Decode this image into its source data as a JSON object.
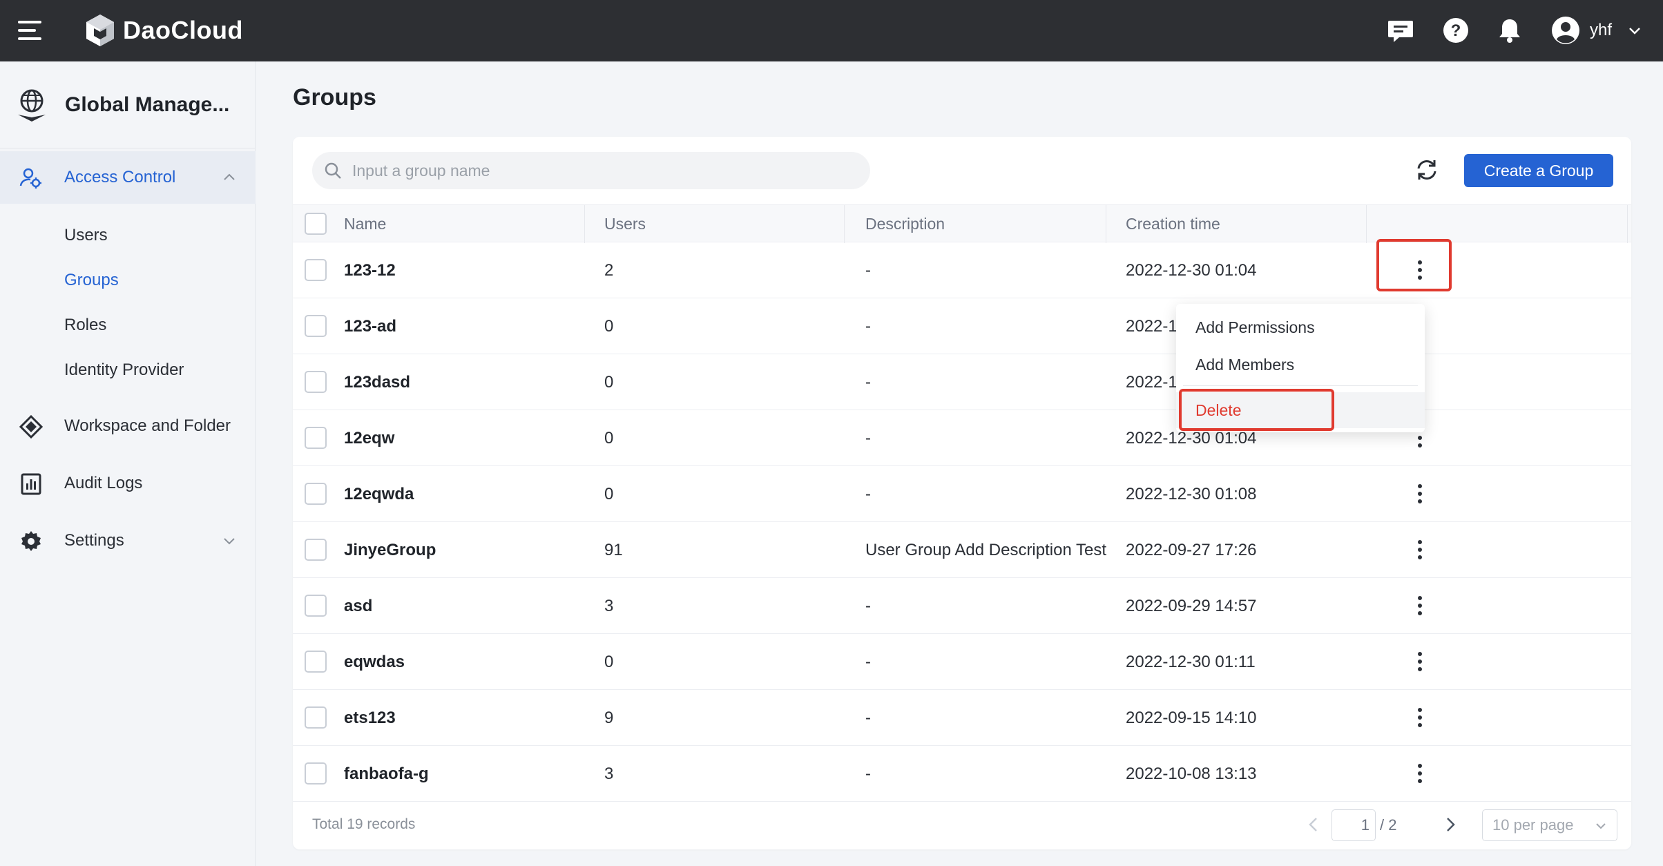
{
  "topbar": {
    "brand": "DaoCloud",
    "user_name": "yhf",
    "icons": [
      "menu-icon",
      "logo-icon",
      "message-icon",
      "help-icon",
      "bell-icon",
      "user-avatar-icon",
      "chevron-down-icon"
    ]
  },
  "sidebar": {
    "module_title": "Global Manage...",
    "access_control": "Access Control",
    "sub_items": [
      "Users",
      "Groups",
      "Roles",
      "Identity Provider"
    ],
    "active_sub": "Groups",
    "workspace": "Workspace and Folder",
    "audit": "Audit Logs",
    "settings": "Settings"
  },
  "page": {
    "title": "Groups",
    "search_placeholder": "Input a group name",
    "create_label": "Create a Group"
  },
  "table": {
    "columns": [
      "Name",
      "Users",
      "Description",
      "Creation time"
    ],
    "rows": [
      {
        "name": "123-12",
        "users": "2",
        "description": "-",
        "created": "2022-12-30 01:04"
      },
      {
        "name": "123-ad",
        "users": "0",
        "description": "-",
        "created": "2022-1"
      },
      {
        "name": "123dasd",
        "users": "0",
        "description": "-",
        "created": "2022-1"
      },
      {
        "name": "12eqw",
        "users": "0",
        "description": "-",
        "created": "2022-12-30 01:04"
      },
      {
        "name": "12eqwda",
        "users": "0",
        "description": "-",
        "created": "2022-12-30 01:08"
      },
      {
        "name": "JinyeGroup",
        "users": "91",
        "description": "User Group Add Description Test",
        "created": "2022-09-27 17:26"
      },
      {
        "name": "asd",
        "users": "3",
        "description": "-",
        "created": "2022-09-29 14:57"
      },
      {
        "name": "eqwdas",
        "users": "0",
        "description": "-",
        "created": "2022-12-30 01:11"
      },
      {
        "name": "ets123",
        "users": "9",
        "description": "-",
        "created": "2022-09-15 14:10"
      },
      {
        "name": "fanbaofa-g",
        "users": "3",
        "description": "-",
        "created": "2022-10-08 13:13"
      }
    ]
  },
  "menu": {
    "add_permissions": "Add Permissions",
    "add_members": "Add Members",
    "delete": "Delete"
  },
  "footer": {
    "total": "Total 19 records",
    "page": "1",
    "pages": "/ 2",
    "per_page": "10 per page"
  },
  "colors": {
    "topbar": "#2d2f33",
    "accent": "#2563d3",
    "danger": "#e03a2f"
  }
}
